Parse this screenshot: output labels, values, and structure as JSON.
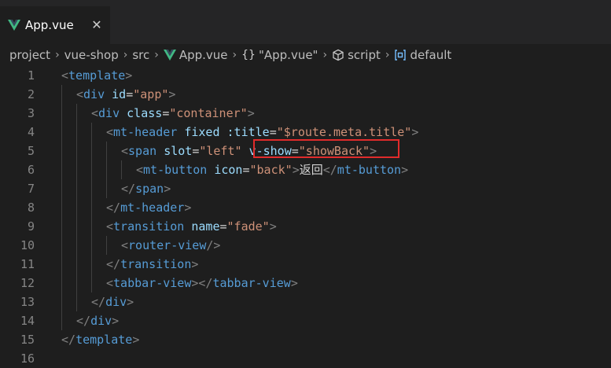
{
  "tab": {
    "label": "App.vue",
    "close_symbol": "✕"
  },
  "breadcrumb": {
    "items": [
      "project",
      "vue-shop",
      "src",
      "App.vue",
      "\"App.vue\"",
      "script",
      "default"
    ],
    "separator": "›"
  },
  "colors": {
    "vue_green": "#41b883",
    "vue_dark": "#35495e",
    "highlight_red": "#e02b2b"
  },
  "editor": {
    "lines": [
      {
        "n": "1",
        "indent": 0,
        "tokens": [
          [
            "p",
            "<"
          ],
          [
            "t",
            "template"
          ],
          [
            "p",
            ">"
          ]
        ]
      },
      {
        "n": "2",
        "indent": 1,
        "tokens": [
          [
            "p",
            "<"
          ],
          [
            "t",
            "div"
          ],
          [
            "s",
            " "
          ],
          [
            "a",
            "id"
          ],
          [
            "e",
            "="
          ],
          [
            "v",
            "\"app\""
          ],
          [
            "p",
            ">"
          ]
        ]
      },
      {
        "n": "3",
        "indent": 2,
        "tokens": [
          [
            "p",
            "<"
          ],
          [
            "t",
            "div"
          ],
          [
            "s",
            " "
          ],
          [
            "a",
            "class"
          ],
          [
            "e",
            "="
          ],
          [
            "v",
            "\"container\""
          ],
          [
            "p",
            ">"
          ]
        ]
      },
      {
        "n": "4",
        "indent": 3,
        "tokens": [
          [
            "p",
            "<"
          ],
          [
            "t",
            "mt-header"
          ],
          [
            "s",
            " "
          ],
          [
            "a",
            "fixed"
          ],
          [
            "s",
            " "
          ],
          [
            "a",
            ":title"
          ],
          [
            "e",
            "="
          ],
          [
            "v",
            "\"$route.meta.title\""
          ],
          [
            "p",
            ">"
          ]
        ]
      },
      {
        "n": "5",
        "indent": 4,
        "tokens": [
          [
            "p",
            "<"
          ],
          [
            "t",
            "span"
          ],
          [
            "s",
            " "
          ],
          [
            "a",
            "slot"
          ],
          [
            "e",
            "="
          ],
          [
            "v",
            "\"left\""
          ],
          [
            "s",
            " "
          ],
          [
            "a",
            "v-show"
          ],
          [
            "e",
            "="
          ],
          [
            "v",
            "\"showBack\""
          ],
          [
            "p",
            ">"
          ]
        ]
      },
      {
        "n": "6",
        "indent": 5,
        "tokens": [
          [
            "p",
            "<"
          ],
          [
            "t",
            "mt-button"
          ],
          [
            "s",
            " "
          ],
          [
            "a",
            "icon"
          ],
          [
            "e",
            "="
          ],
          [
            "v",
            "\"back\""
          ],
          [
            "p",
            ">"
          ],
          [
            "x",
            "返回"
          ],
          [
            "p",
            "</"
          ],
          [
            "t",
            "mt-button"
          ],
          [
            "p",
            ">"
          ]
        ]
      },
      {
        "n": "7",
        "indent": 4,
        "tokens": [
          [
            "p",
            "</"
          ],
          [
            "t",
            "span"
          ],
          [
            "p",
            ">"
          ]
        ]
      },
      {
        "n": "8",
        "indent": 3,
        "tokens": [
          [
            "p",
            "</"
          ],
          [
            "t",
            "mt-header"
          ],
          [
            "p",
            ">"
          ]
        ]
      },
      {
        "n": "9",
        "indent": 3,
        "tokens": [
          [
            "p",
            "<"
          ],
          [
            "t",
            "transition"
          ],
          [
            "s",
            " "
          ],
          [
            "a",
            "name"
          ],
          [
            "e",
            "="
          ],
          [
            "v",
            "\"fade\""
          ],
          [
            "p",
            ">"
          ]
        ]
      },
      {
        "n": "10",
        "indent": 4,
        "tokens": [
          [
            "p",
            "<"
          ],
          [
            "t",
            "router-view"
          ],
          [
            "p",
            "/>"
          ]
        ]
      },
      {
        "n": "11",
        "indent": 3,
        "tokens": [
          [
            "p",
            "</"
          ],
          [
            "t",
            "transition"
          ],
          [
            "p",
            ">"
          ]
        ]
      },
      {
        "n": "12",
        "indent": 3,
        "tokens": [
          [
            "p",
            "<"
          ],
          [
            "t",
            "tabbar-view"
          ],
          [
            "p",
            "></"
          ],
          [
            "t",
            "tabbar-view"
          ],
          [
            "p",
            ">"
          ]
        ]
      },
      {
        "n": "13",
        "indent": 2,
        "tokens": [
          [
            "p",
            "</"
          ],
          [
            "t",
            "div"
          ],
          [
            "p",
            ">"
          ]
        ]
      },
      {
        "n": "14",
        "indent": 1,
        "tokens": [
          [
            "p",
            "</"
          ],
          [
            "t",
            "div"
          ],
          [
            "p",
            ">"
          ]
        ]
      },
      {
        "n": "15",
        "indent": 0,
        "tokens": [
          [
            "p",
            "</"
          ],
          [
            "t",
            "template"
          ],
          [
            "p",
            ">"
          ]
        ]
      },
      {
        "n": "16",
        "indent": 0,
        "tokens": []
      }
    ]
  }
}
